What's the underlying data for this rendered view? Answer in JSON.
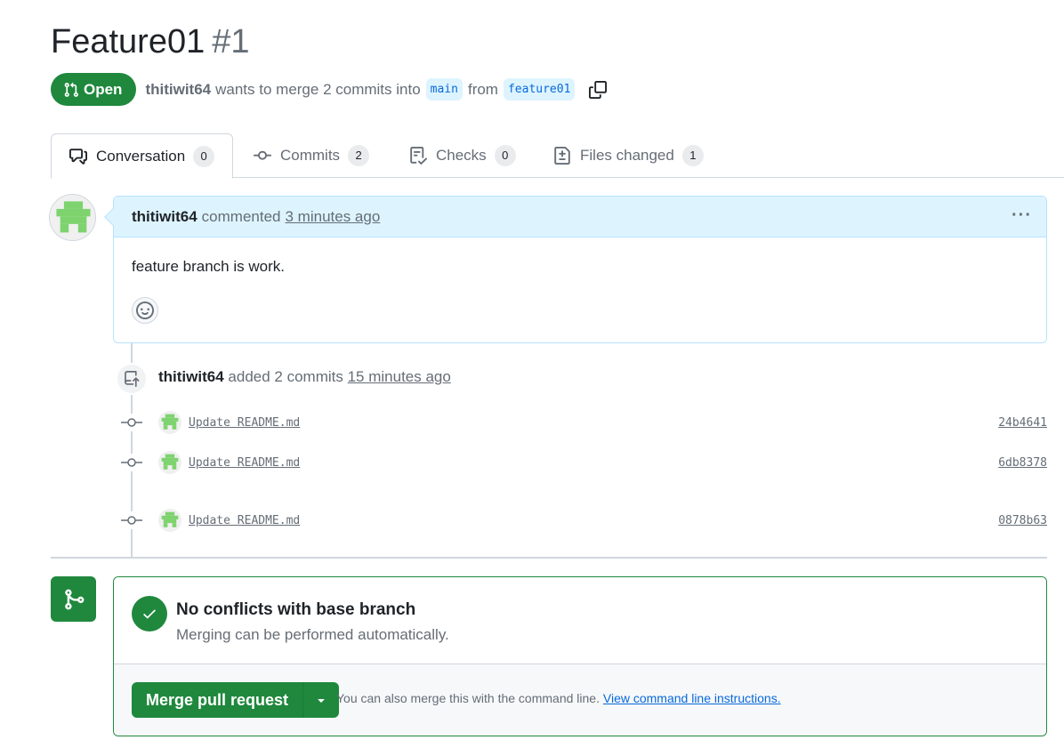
{
  "pr": {
    "title": "Feature01",
    "number": "#1",
    "state": "Open",
    "author": "thitiwit64",
    "merge_text_1": "wants to merge 2 commits into",
    "base_branch": "main",
    "merge_text_2": "from",
    "head_branch": "feature01"
  },
  "tabs": [
    {
      "label": "Conversation",
      "count": "0",
      "icon": "comment-discussion-icon"
    },
    {
      "label": "Commits",
      "count": "2",
      "icon": "git-commit-icon"
    },
    {
      "label": "Checks",
      "count": "0",
      "icon": "checklist-icon"
    },
    {
      "label": "Files changed",
      "count": "1",
      "icon": "file-diff-icon"
    }
  ],
  "comment": {
    "author": "thitiwit64",
    "action": "commented",
    "time": "3 minutes ago",
    "body": "feature branch is work."
  },
  "commit_event": {
    "author": "thitiwit64",
    "action": "added 2 commits",
    "time": "15 minutes ago"
  },
  "commits": [
    {
      "message": "Update README.md",
      "sha": "24b4641"
    },
    {
      "message": "Update README.md",
      "sha": "6db8378"
    },
    {
      "message": "Update README.md",
      "sha": "0878b63"
    }
  ],
  "merge": {
    "title": "No conflicts with base branch",
    "subtitle": "Merging can be performed automatically.",
    "button_label": "Merge pull request",
    "hint": "You can also merge this with the command line.",
    "hint_link": "View command line instructions."
  },
  "colors": {
    "accent_green": "#1f883d",
    "link_blue": "#0969da",
    "header_blue": "#ddf4ff"
  }
}
